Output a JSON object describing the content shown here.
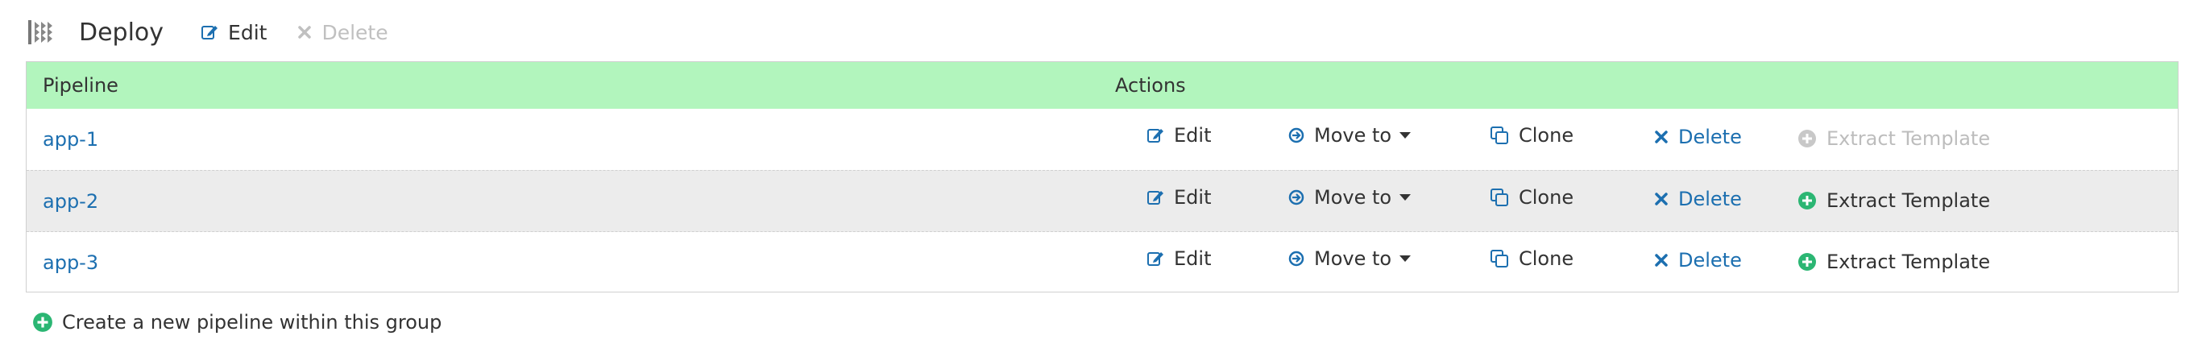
{
  "header": {
    "title": "Deploy",
    "edit_label": "Edit",
    "delete_label": "Delete"
  },
  "table": {
    "columns": [
      "Pipeline",
      "Actions"
    ],
    "rows": [
      {
        "name": "app-1",
        "extract_enabled": false
      },
      {
        "name": "app-2",
        "extract_enabled": true
      },
      {
        "name": "app-3",
        "extract_enabled": true
      }
    ]
  },
  "actions": {
    "edit": "Edit",
    "move": "Move to",
    "clone": "Clone",
    "delete": "Delete",
    "extract": "Extract Template"
  },
  "footer": {
    "create_label": "Create a new pipeline within this group"
  },
  "colors": {
    "header_bg": "#b2f5bd",
    "link": "#1c6fb0",
    "accent_green": "#2bb673",
    "disabled": "#bdbdbd"
  }
}
